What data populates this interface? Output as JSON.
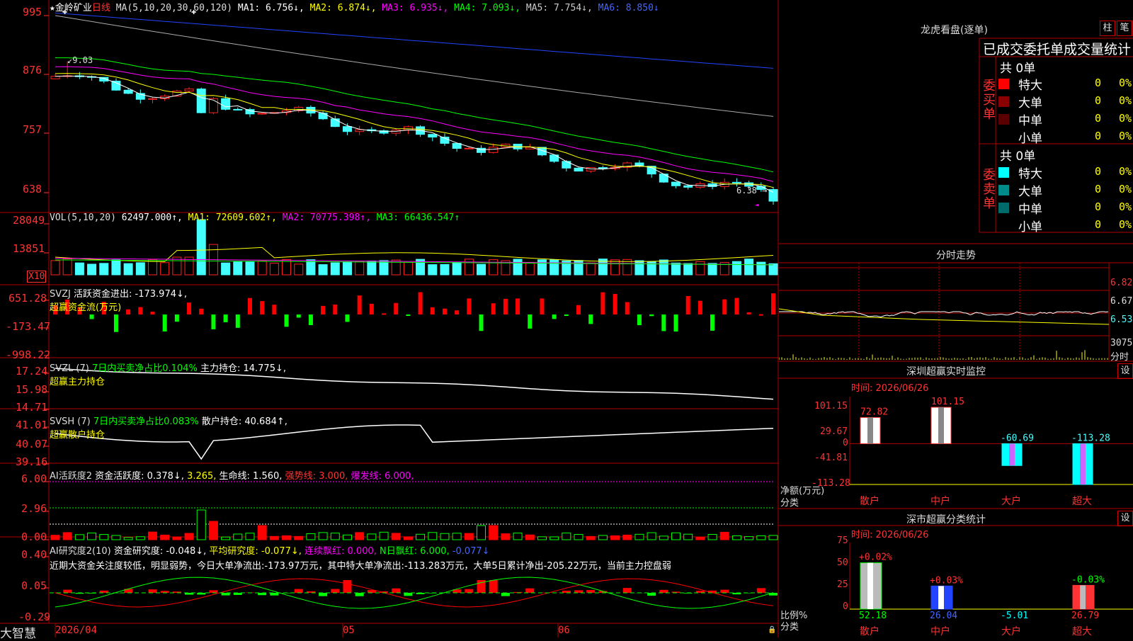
{
  "colors": {
    "up": "#ff2222",
    "down": "#44ffff",
    "grid": "#b00000",
    "ma1": "#ffffff",
    "ma2": "#ffff00",
    "ma3": "#ff00ff",
    "ma4": "#00ff00",
    "ma5": "#aaaaaa",
    "ma6": "#2244ff"
  },
  "main": {
    "star": "★",
    "stock_name": "金岭矿业",
    "period": "日线",
    "ma_label": "MA(5,10,20,30,60,120)",
    "ma": [
      {
        "label": "MA1: 6.756↓,",
        "color": "#ffffff"
      },
      {
        "label": "MA2: 6.874↓,",
        "color": "#ffff00"
      },
      {
        "label": "MA3: 6.935↓,",
        "color": "#ff00ff"
      },
      {
        "label": "MA4: 7.093↓,",
        "color": "#00ff00"
      },
      {
        "label": "MA5: 7.754↓,",
        "color": "#aaaaaa"
      },
      {
        "label": "MA6: 8.850↓",
        "color": "#2244ff"
      }
    ],
    "y_ticks": [
      "995",
      "876",
      "757",
      "638"
    ],
    "high_label": "9.03",
    "low_label": "6.38"
  },
  "vol": {
    "title": "VOL(5,10,20)",
    "value": "62497.000↑,",
    "ma1": "MA1: 72609.602↑,",
    "ma2": "MA2: 70775.398↑,",
    "ma3": "MA3: 66436.547↑",
    "y_ticks": [
      "28049",
      "13851"
    ],
    "unit": "X10"
  },
  "svzj": {
    "title": "SVZJ",
    "label": "活跃资金进出: -173.974↓,",
    "subtitle": "超赢资金流(万元)",
    "y_ticks": [
      "651.28",
      "-173.47",
      "-998.22"
    ]
  },
  "svzl": {
    "title": "SVZL (7)",
    "label1": "7日内买卖净占比0.104%",
    "label2": "主力持仓: 14.775↓,",
    "subtitle": "超赢主力持仓",
    "y_ticks": [
      "17.24",
      "15.98",
      "14.71"
    ]
  },
  "svsh": {
    "title": "SVSH (7)",
    "label1": "7日内买卖净占比0.083%",
    "label2": "散户持仓: 40.684↑,",
    "subtitle": "超赢散户持仓",
    "y_ticks": [
      "41.01",
      "40.07",
      "39.16"
    ]
  },
  "ai1": {
    "title": "AI活跃度2",
    "label1": "资金活跃度: 0.378↓,",
    "label2": "3.265,",
    "label3": "生命线: 1.560,",
    "label4": "强势线: 3.000,",
    "label5": "爆发线: 6.000,",
    "y_ticks": [
      "6.00",
      "2.96",
      "0.00"
    ]
  },
  "ai2": {
    "title": "AI研究度2(10)",
    "label1": "资金研究度: -0.048↓,",
    "label2": "平均研究度: -0.077↓,",
    "label3": "连续飘红: 0.000,",
    "label4": "N日飘红: 6.000,",
    "label5": "-0.077↓",
    "comment": "近期大资金关注度较低，明显弱势，今日大单净流出:-173.97万元，其中特大单净流出:-113.283万元，大单5日累计净出-205.22万元，当前主力控盘弱",
    "y_ticks": [
      "0.40",
      "0.05",
      "-0.29"
    ]
  },
  "bottom": {
    "brand": "大智慧",
    "dates": [
      "2026/04",
      "05",
      "06"
    ]
  },
  "right": {
    "title": "龙虎看盘(逐单)",
    "btn_zhu": "柱",
    "btn_bi": "笔",
    "tabs_line": "已成交委托单成交量统计",
    "buy_label": "委买单",
    "sell_label": "委卖单",
    "buy_total": "共 0单",
    "sell_total": "共 0单",
    "buy_rows": [
      {
        "name": "特大",
        "count": "0",
        "pct": "0%",
        "color": "#ff0000"
      },
      {
        "name": "大单",
        "count": "0",
        "pct": "0%",
        "color": "#8b0000"
      },
      {
        "name": "中单",
        "count": "0",
        "pct": "0%",
        "color": "#5a0000"
      },
      {
        "name": "小单",
        "count": "0",
        "pct": "0%",
        "color": "#000000"
      }
    ],
    "sell_rows": [
      {
        "name": "特大",
        "count": "0",
        "pct": "0%",
        "color": "#00ffff"
      },
      {
        "name": "大单",
        "count": "0",
        "pct": "0%",
        "color": "#008b8b"
      },
      {
        "name": "中单",
        "count": "0",
        "pct": "0%",
        "color": "#006b6b"
      },
      {
        "name": "小单",
        "count": "0",
        "pct": "0%",
        "color": "#000000"
      }
    ],
    "intraday_title": "分时走势",
    "intraday_ticks": [
      "6.82",
      "6.67",
      "6.53",
      "3075"
    ],
    "intraday_unit": "分时",
    "monitor_title": "深圳超赢实时监控",
    "monitor_btn": "设",
    "monitor_time": "时间: 2026/06/26",
    "monitor_y": [
      "101.15",
      "29.67",
      "0",
      "-41.81",
      "-113.28"
    ],
    "monitor_ylabel": "净额(万元)",
    "monitor_xlabel": "分类",
    "stats_title": "深市超赢分类统计",
    "stats_btn": "设",
    "stats_time": "时间: 2026/06/26",
    "stats_y": [
      "75",
      "50",
      "25",
      "0"
    ],
    "stats_ylabel": "比例%",
    "stats_xlabel": "分类"
  },
  "chart_data": [
    {
      "type": "bar",
      "title": "深圳超赢实时监控",
      "categories": [
        "散户",
        "中户",
        "大户",
        "超大"
      ],
      "values": [
        72.82,
        101.15,
        -60.69,
        -113.28
      ],
      "ylim": [
        -113.28,
        101.15
      ],
      "ylabel": "净额(万元)",
      "xlabel": "分类"
    },
    {
      "type": "bar",
      "title": "深市超赢分类统计",
      "categories": [
        "散户",
        "中户",
        "大户",
        "超大"
      ],
      "values": [
        52.18,
        26.04,
        -5.01,
        26.79
      ],
      "top_labels": [
        "+0.02%",
        "+0.03%",
        "",
        "-0.03%"
      ],
      "ylim": [
        0,
        75
      ],
      "ylabel": "比例%",
      "xlabel": "分类"
    }
  ]
}
